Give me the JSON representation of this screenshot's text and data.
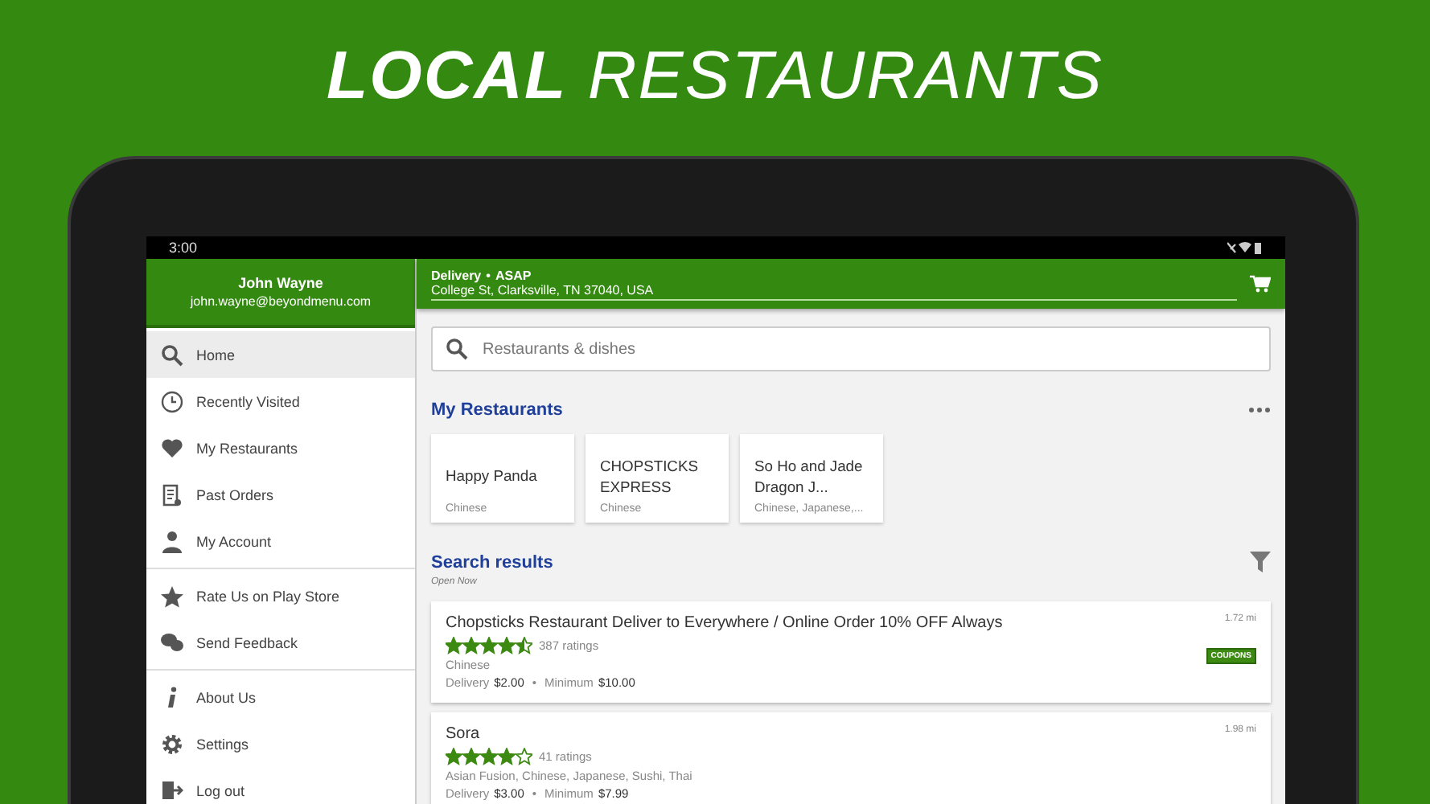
{
  "banner": {
    "title": "**LOCAL** RESTAURANTS"
  },
  "status_bar": {
    "time": "3:00"
  },
  "drawer": {
    "user_name": "John Wayne",
    "user_email": "john.wayne@beyondmenu.com",
    "groups": [
      [
        {
          "label": "Home",
          "selected": true
        },
        {
          "label": "Recently Visited",
          "selected": false
        },
        {
          "label": "My Restaurants",
          "selected": false
        },
        {
          "label": "Past Orders",
          "selected": false
        },
        {
          "label": "My Account",
          "selected": false
        }
      ],
      [
        {
          "label": "Rate Us on Play Store",
          "selected": false
        },
        {
          "label": "Send Feedback",
          "selected": false
        }
      ],
      [
        {
          "label": "About Us",
          "selected": false
        },
        {
          "label": "Settings",
          "selected": false
        },
        {
          "label": "Log out",
          "selected": false
        }
      ]
    ]
  },
  "top_bar": {
    "mode": "Delivery",
    "separator": "•",
    "time": "ASAP",
    "address": "College St, Clarksville, TN 37040, USA"
  },
  "search": {
    "placeholder": "Restaurants & dishes"
  },
  "my_restaurants": {
    "title": "My Restaurants",
    "items": [
      {
        "name": "Happy Panda",
        "cuisine": "Chinese"
      },
      {
        "name": "CHOPSTICKS EXPRESS",
        "cuisine": "Chinese"
      },
      {
        "name": "So Ho and Jade Dragon J...",
        "cuisine": "Chinese, Japanese,..."
      }
    ]
  },
  "search_results": {
    "title": "Search results",
    "subtitle": "Open Now",
    "items": [
      {
        "name": "Chopsticks Restaurant Deliver to Everywhere / Online Order 10% OFF Always",
        "stars": 4.5,
        "ratings": "387 ratings",
        "cuisine": "Chinese",
        "delivery_label": "Delivery",
        "delivery": "$2.00",
        "minimum_label": "Minimum",
        "minimum": "$10.00",
        "distance": "1.72 mi",
        "badge": "COUPONS"
      },
      {
        "name": "Sora",
        "stars": 4,
        "ratings": "41 ratings",
        "cuisine": "Asian Fusion, Chinese, Japanese, Sushi, Thai",
        "delivery_label": "Delivery",
        "delivery": "$3.00",
        "minimum_label": "Minimum",
        "minimum": "$7.99",
        "distance": "1.98 mi"
      }
    ]
  }
}
